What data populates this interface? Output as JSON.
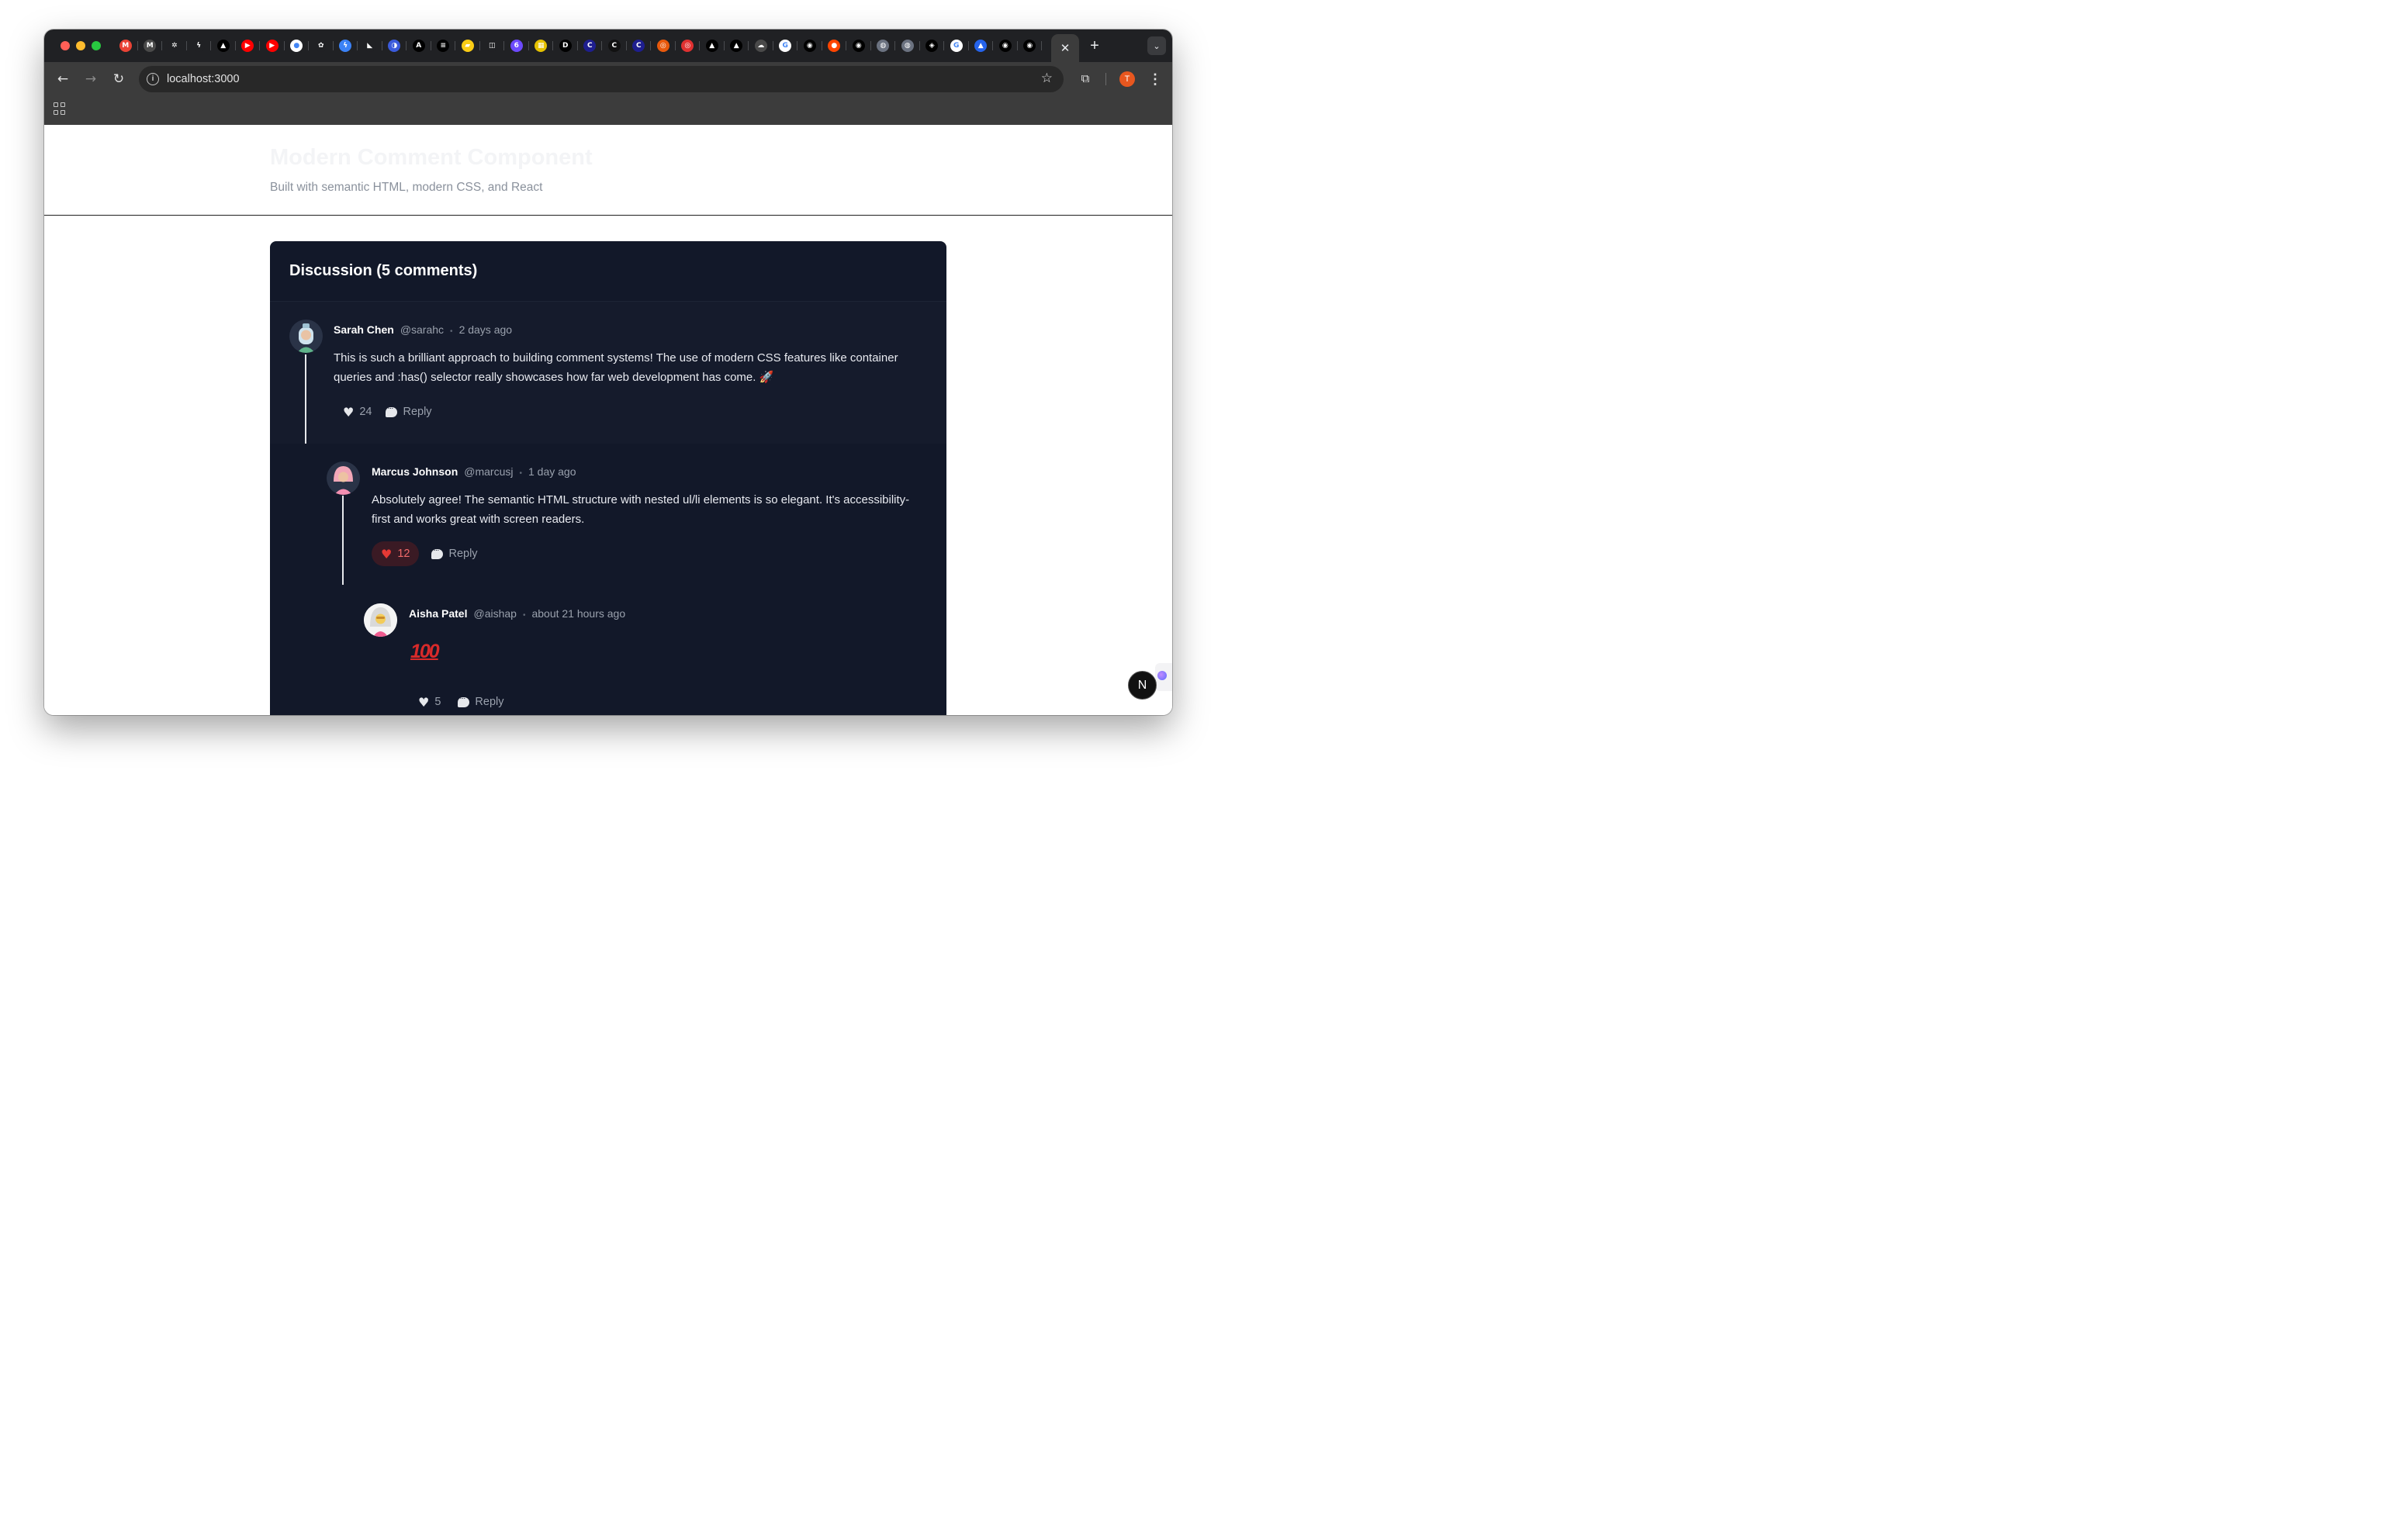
{
  "browser": {
    "url": "localhost:3000",
    "profile_initial": "T",
    "active_tab_close": "✕",
    "new_tab": "+"
  },
  "tabs": [
    {
      "icon": "gmail-icon",
      "glyph": "M",
      "color": "#ea4335"
    },
    {
      "icon": "gmail-icon",
      "glyph": "M",
      "color": "#4a4a4a"
    },
    {
      "icon": "openai-icon",
      "glyph": "✲",
      "color": "#202124"
    },
    {
      "icon": "bolt-icon",
      "glyph": "ϟ",
      "color": "#202124"
    },
    {
      "icon": "triangle-icon",
      "glyph": "▲",
      "color": "#000000"
    },
    {
      "icon": "youtube-icon",
      "glyph": "▶",
      "color": "#ff0000"
    },
    {
      "icon": "youtube-icon",
      "glyph": "▶",
      "color": "#ff0000"
    },
    {
      "icon": "circle-icon",
      "glyph": "●",
      "color": "#ffffff"
    },
    {
      "icon": "flower-icon",
      "glyph": "✿",
      "color": "#202124"
    },
    {
      "icon": "zap-icon",
      "glyph": "ϟ",
      "color": "#3b82f6"
    },
    {
      "icon": "arrow-icon",
      "glyph": "◣",
      "color": "#202124"
    },
    {
      "icon": "orb-icon",
      "glyph": "◑",
      "color": "#3b5bdb"
    },
    {
      "icon": "a-icon",
      "glyph": "A",
      "color": "#000000"
    },
    {
      "icon": "stack-icon",
      "glyph": "≡",
      "color": "#000000"
    },
    {
      "icon": "yellow-icon",
      "glyph": "▰",
      "color": "#facc15"
    },
    {
      "icon": "frame-icon",
      "glyph": "◫",
      "color": "#202124"
    },
    {
      "icon": "six-icon",
      "glyph": "6",
      "color": "#6d4aff"
    },
    {
      "icon": "book-icon",
      "glyph": "▦",
      "color": "#e5c100"
    },
    {
      "icon": "d-icon",
      "glyph": "D",
      "color": "#000000"
    },
    {
      "icon": "c-icon",
      "glyph": "C",
      "color": "#1e1e8f"
    },
    {
      "icon": "c-icon",
      "glyph": "C",
      "color": "#111111"
    },
    {
      "icon": "c-icon",
      "glyph": "C",
      "color": "#1e1e8f"
    },
    {
      "icon": "ring-icon",
      "glyph": "◎",
      "color": "#e8590c"
    },
    {
      "icon": "ring-icon",
      "glyph": "◎",
      "color": "#e03131"
    },
    {
      "icon": "triangle-icon",
      "glyph": "▲",
      "color": "#000000"
    },
    {
      "icon": "triangle-icon",
      "glyph": "▲",
      "color": "#000000"
    },
    {
      "icon": "cloud-icon",
      "glyph": "☁",
      "color": "#4a4a4a"
    },
    {
      "icon": "google-icon",
      "glyph": "G",
      "color": "#ffffff"
    },
    {
      "icon": "github-icon",
      "glyph": "◉",
      "color": "#000000"
    },
    {
      "icon": "reddit-icon",
      "glyph": "●",
      "color": "#ff4500"
    },
    {
      "icon": "github-icon",
      "glyph": "◉",
      "color": "#000000"
    },
    {
      "icon": "globe-icon",
      "glyph": "◍",
      "color": "#6b7280"
    },
    {
      "icon": "globe-icon",
      "glyph": "◍",
      "color": "#6b7280"
    },
    {
      "icon": "codepen-icon",
      "glyph": "◈",
      "color": "#000000"
    },
    {
      "icon": "google-icon",
      "glyph": "G",
      "color": "#ffffff"
    },
    {
      "icon": "atlassian-icon",
      "glyph": "▲",
      "color": "#2563eb"
    },
    {
      "icon": "github-icon",
      "glyph": "◉",
      "color": "#000000"
    },
    {
      "icon": "github-icon",
      "glyph": "◉",
      "color": "#000000"
    }
  ],
  "hero": {
    "title": "Modern Comment Component",
    "subtitle": "Built with semantic HTML, modern CSS, and React"
  },
  "discussion": {
    "title": "Discussion (5 comments)",
    "comments": [
      {
        "author": "Sarah Chen",
        "handle": "@sarahc",
        "separator": "•",
        "time": "2 days ago",
        "text": "This is such a brilliant approach to building comment systems! The use of modern CSS features like container queries and :has() selector really showcases how far web development has come. 🚀",
        "likes": "24",
        "liked": false,
        "heart": "♥",
        "reply_label": "Reply"
      },
      {
        "author": "Marcus Johnson",
        "handle": "@marcusj",
        "separator": "•",
        "time": "1 day ago",
        "text": "Absolutely agree! The semantic HTML structure with nested ul/li elements is so elegant. It's accessibility-first and works great with screen readers.",
        "likes": "12",
        "liked": true,
        "heart": "♥",
        "reply_label": "Reply"
      },
      {
        "author": "Aisha Patel",
        "handle": "@aishap",
        "separator": "•",
        "time": "about 21 hours ago",
        "text": "100",
        "likes": "5",
        "liked": false,
        "heart": "♥",
        "reply_label": "Reply"
      }
    ]
  },
  "devtools_button": "N",
  "colors": {
    "card_bg": "#121829",
    "liked": "#f26a6a",
    "accent_profile": "#e8571f"
  }
}
